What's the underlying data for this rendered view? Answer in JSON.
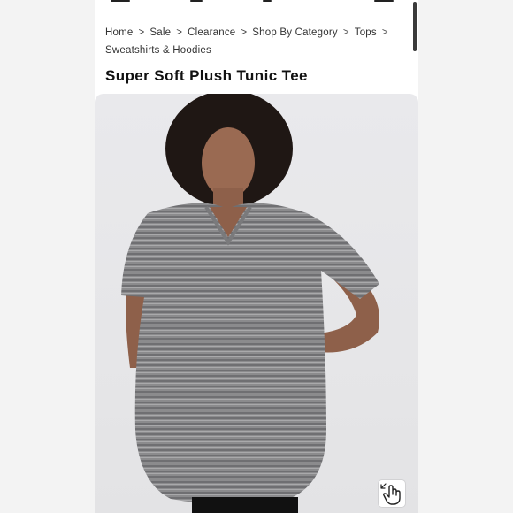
{
  "breadcrumb": {
    "items": [
      "Home",
      "Sale",
      "Clearance",
      "Shop By Category",
      "Tops",
      "Sweatshirts & Hoodies"
    ],
    "separator": ">"
  },
  "product": {
    "title": "Super Soft Plush Tunic Tee",
    "image_description": "model-wearing-grey-spacedye-tunic"
  },
  "icons": {
    "tap_gesture": "hand-tap-icon"
  },
  "colors": {
    "background": "#ffffff",
    "text": "#111111",
    "image_bg": "#e8e8ea",
    "tee": "#8a8a8c"
  }
}
